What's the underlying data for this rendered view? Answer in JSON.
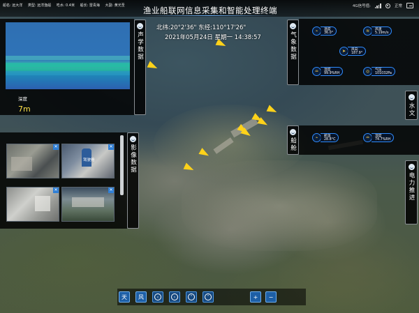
{
  "header": {
    "title": "渔业船联网信息采集和智能处理终端",
    "ship_info": [
      "船名: 远大洋",
      "类型: 远洋渔船",
      "吃水: 0.4米",
      "船长: 雷青海",
      "大副: 黄光圣"
    ],
    "signal_label": "4G信号值:",
    "status_label": "正常"
  },
  "location": {
    "coordinates": "北纬:20°2'36\" 东经:110°17'26\"",
    "datetime": "2021年05月24日 星期一  14:38:57"
  },
  "acoustic_panel": {
    "tab_label": "声学数据",
    "depth_label": "深度",
    "depth_value": "7m"
  },
  "video_panel": {
    "tab_label": "影像数据",
    "videos": [
      {
        "label": ""
      },
      {
        "label": "驾驶舱"
      },
      {
        "label": ""
      },
      {
        "label": ""
      }
    ],
    "close_glyph": "✕"
  },
  "weather_panel": {
    "tab_label": "气象数据",
    "items": [
      {
        "name": "温度",
        "value": "36.0°",
        "icon": "thermometer-icon"
      },
      {
        "name": "风速",
        "value": "5.19m/s",
        "icon": "wind-speed-icon"
      },
      {
        "name": "风向",
        "value": "187.9°",
        "icon": "wind-direction-icon"
      },
      {
        "name": "湿度",
        "value": "99.9%RH",
        "icon": "humidity-icon"
      },
      {
        "name": "气压",
        "value": "101032Pa",
        "icon": "pressure-icon"
      }
    ]
  },
  "hydrology_tab": {
    "label": "水文"
  },
  "cabin_panel": {
    "tab_label": "船舱",
    "items": [
      {
        "name": "舱温",
        "value": "28.8°C",
        "icon": "cabin-temperature-icon"
      },
      {
        "name": "湿度",
        "value": "74.7%RH",
        "icon": "cabin-humidity-icon"
      }
    ]
  },
  "power_tab": {
    "label": "电力推进"
  },
  "toolbar": {
    "day_label": "天",
    "wind_label": "风",
    "zoom_in_label": "+",
    "zoom_out_label": "−"
  },
  "colors": {
    "accent_blue": "#2f8cff",
    "arrow_yellow": "#ffd21a",
    "depth_yellow": "#ffe34a",
    "toolbar_blue": "#17497f"
  }
}
